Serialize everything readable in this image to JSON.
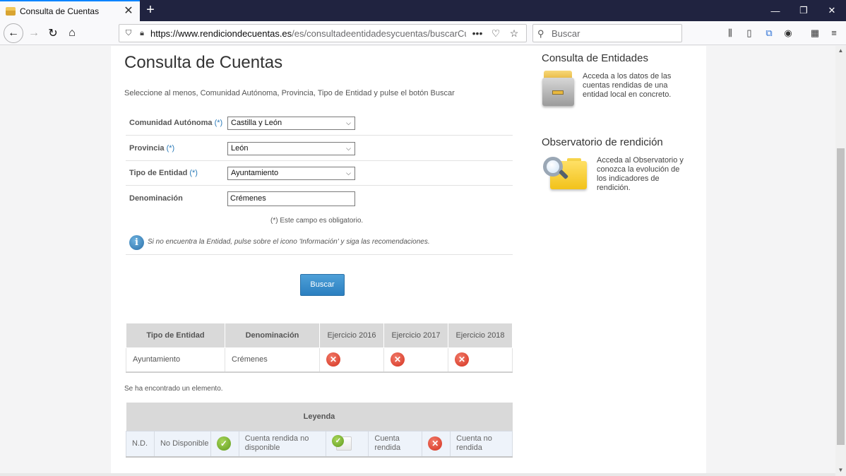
{
  "browser": {
    "tab_title": "Consulta de Cuentas",
    "url_host": "https://www.rendiciondecuentas.es",
    "url_rest": "/es/consultadeentidadesycuentas/buscarCuentas",
    "search_placeholder": "Buscar"
  },
  "page": {
    "title": "Consulta de Cuentas",
    "intro": "Seleccione al menos, Comunidad Autónoma, Provincia, Tipo de Entidad y pulse el botón Buscar",
    "required_mark": "(*)",
    "fields": {
      "comunidad": {
        "label": "Comunidad Autónoma",
        "value": "Castilla y León"
      },
      "provincia": {
        "label": "Provincia",
        "value": "León"
      },
      "tipo": {
        "label": "Tipo de Entidad",
        "value": "Ayuntamiento"
      },
      "denominacion": {
        "label": "Denominación",
        "value": "Crémenes"
      }
    },
    "required_note": "(*) Este campo es obligatorio.",
    "info_text": "Si no encuentra la Entidad, pulse sobre el icono 'Información' y siga las recomendaciones.",
    "search_button": "Buscar",
    "results": {
      "headers": {
        "tipo": "Tipo de Entidad",
        "denominacion": "Denominación",
        "ej2016": "Ejercicio 2016",
        "ej2017": "Ejercicio 2017",
        "ej2018": "Ejercicio 2018"
      },
      "row": {
        "tipo": "Ayuntamiento",
        "denominacion": "Crémenes"
      }
    },
    "found_text": "Se ha encontrado un elemento.",
    "legend": {
      "title": "Leyenda",
      "nd": "N.D.",
      "nd_label": "No Disponible",
      "rendida_nd": "Cuenta rendida no disponible",
      "rendida": "Cuenta rendida",
      "no_rendida": "Cuenta no rendida"
    }
  },
  "sidebar": {
    "entidades": {
      "title": "Consulta de Entidades",
      "text": "Acceda a los datos de las cuentas rendidas de una entidad local en concreto."
    },
    "observatorio": {
      "title": "Observatorio de rendición",
      "text": "Acceda al Observatorio y conozca la evolución de los indicadores de rendición."
    }
  }
}
